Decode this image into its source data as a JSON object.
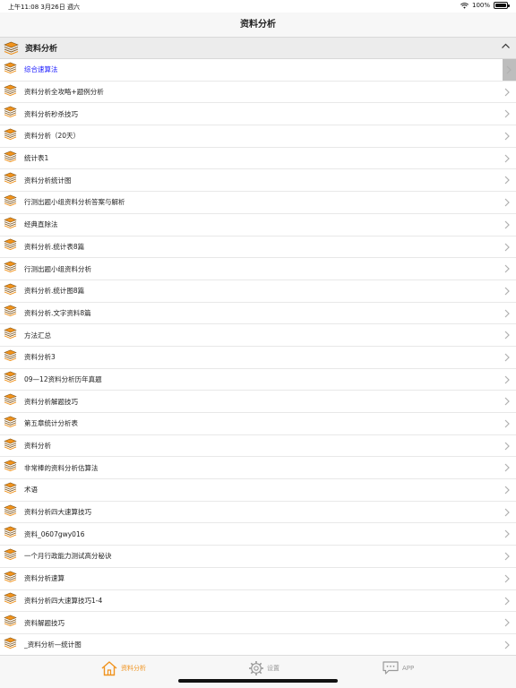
{
  "status_bar": {
    "time_date": "上午11:08  3月26日 週六",
    "battery": "100%",
    "battery_level": 1.0
  },
  "nav": {
    "title": "资料分析"
  },
  "section": {
    "title": "资料分析"
  },
  "items": [
    {
      "label": "综合速算法"
    },
    {
      "label": "资料分析全攻略+题例分析"
    },
    {
      "label": "资料分析秒杀技巧"
    },
    {
      "label": "资料分析（20天）"
    },
    {
      "label": "统计表1"
    },
    {
      "label": "资料分析统计图"
    },
    {
      "label": "行测出题小组资料分析答案与解析"
    },
    {
      "label": "经典直除法"
    },
    {
      "label": "资料分析.统计表8篇"
    },
    {
      "label": "行测出题小组资料分析"
    },
    {
      "label": "资料分析.统计图8篇"
    },
    {
      "label": "资料分析.文字资料8篇"
    },
    {
      "label": "方法汇总"
    },
    {
      "label": "资料分析3"
    },
    {
      "label": "09—12资料分析历年真题"
    },
    {
      "label": "资料分析解题技巧"
    },
    {
      "label": "第五章统计分析表"
    },
    {
      "label": "资料分析"
    },
    {
      "label": "非常棒的资料分析估算法"
    },
    {
      "label": "术语"
    },
    {
      "label": "资料分析四大速算技巧"
    },
    {
      "label": "资料_0607gwy016"
    },
    {
      "label": "一个月行政能力测试高分秘诀"
    },
    {
      "label": "资料分析速算"
    },
    {
      "label": "资料分析四大速算技巧1-4"
    },
    {
      "label": "资料解题技巧"
    },
    {
      "label": "_资料分析—统计图"
    }
  ],
  "tabs": {
    "home": "资料分析",
    "settings": "设置",
    "app": "APP"
  },
  "colors": {
    "accent": "#f0931e",
    "active_link": "#1a1aff",
    "tab_inactive": "#999999"
  }
}
